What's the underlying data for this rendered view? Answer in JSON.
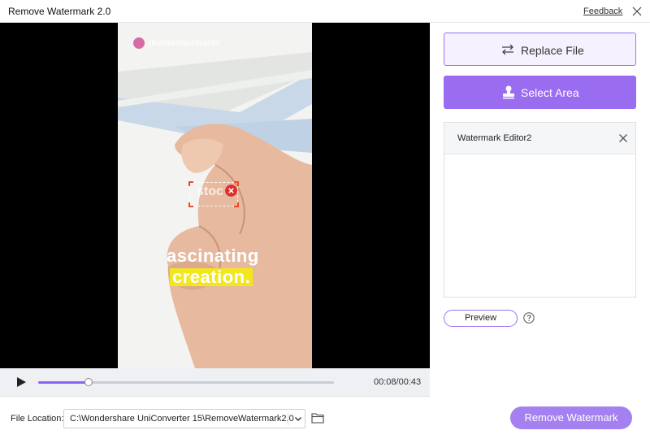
{
  "window": {
    "title": "Remove Watermark 2.0",
    "feedback_label": "Feedback"
  },
  "video": {
    "overlay_handle": "invideo/ainuster",
    "caption_line1": "ascinating",
    "caption_line2": "creation.",
    "watermark_text": "stoc",
    "progress_fraction": 0.171,
    "current_time": "00:08",
    "total_time": "00:43",
    "time_display": "00:08/00:43"
  },
  "sidebar": {
    "replace_label": "Replace File",
    "select_label": "Select Area",
    "editor_title": "Watermark Editor2",
    "preview_label": "Preview"
  },
  "footer": {
    "location_label": "File Location:",
    "location_value": "C:\\Wondershare UniConverter 15\\RemoveWatermark2.0",
    "remove_label": "Remove Watermark"
  },
  "colors": {
    "accent": "#9a6cf0",
    "accent_light": "#a580f1",
    "caption_highlight": "#f2e71d",
    "close_red": "#e02d2d"
  },
  "icons": {
    "replace": "swap-arrows-icon",
    "select": "stamp-icon",
    "close": "close-icon",
    "help": "help-icon",
    "folder": "folder-icon",
    "dropdown": "chevron-down-icon",
    "play": "play-icon"
  }
}
